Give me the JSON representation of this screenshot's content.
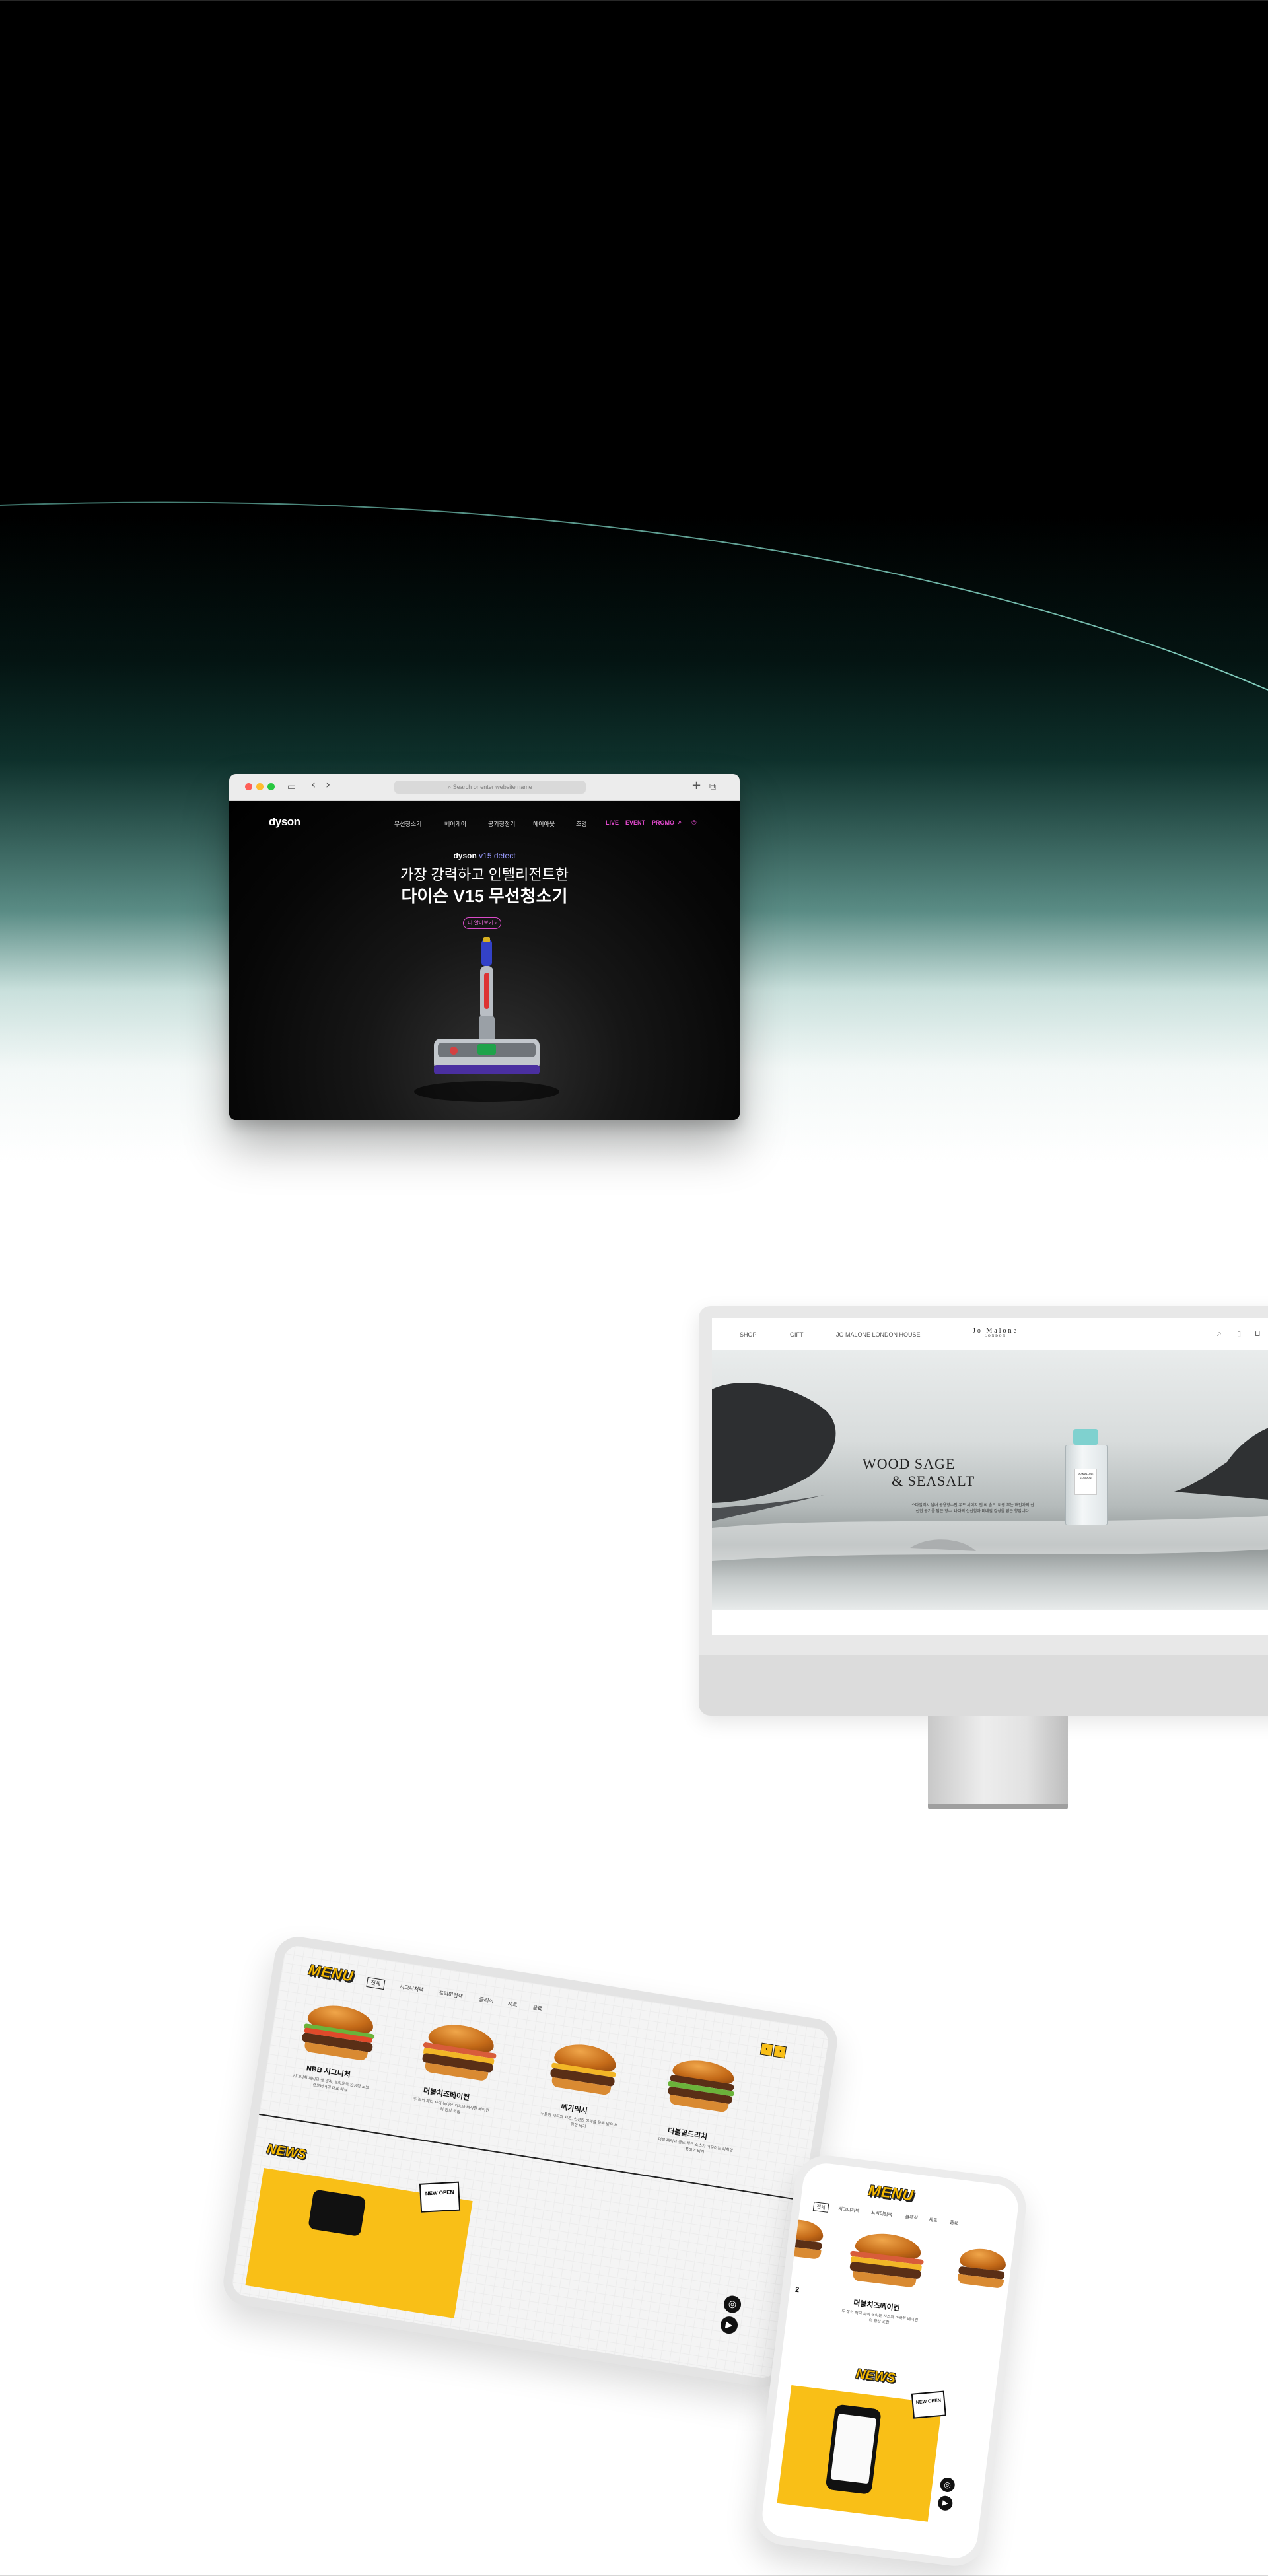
{
  "dyson": {
    "browser": {
      "url_placeholder": "Search or enter website name",
      "back_glyph": "‹",
      "forward_glyph": "›",
      "plus_glyph": "+",
      "tabs_glyph": "⧉",
      "sidebar_glyph": "▭",
      "traffic_colors": [
        "#ff5f57",
        "#febc2e",
        "#28c840"
      ]
    },
    "logo": "dyson",
    "nav": [
      "무선청소기",
      "헤어케어",
      "공기청정기",
      "헤어아웃",
      "조명"
    ],
    "nav_highlight": [
      "LIVE",
      "EVENT",
      "PROMO"
    ],
    "nav_icons": [
      "search-icon",
      "user-icon"
    ],
    "hero": {
      "product_brand": "dyson",
      "product_model": "v15 detect",
      "headline": "가장 강력하고 인텔리전트한",
      "title": "다이슨 V15 무선청소기",
      "cta": "더 알아보기 ›"
    },
    "accent_color": "#e54bd0"
  },
  "jomalone": {
    "nav": [
      "SHOP",
      "GIFT",
      "JO MALONE LONDON HOUSE"
    ],
    "logo_line1": "Jo Malone",
    "logo_line2": "LONDON",
    "icons": [
      "search-icon",
      "bookmark-icon",
      "bag-icon"
    ],
    "hero_title_1": "WOOD SAGE",
    "hero_title_2": "& SEASALT",
    "hero_desc": "스타일리시 남녀 공용향수인 우드 세이지 앤 씨 솔트. 바람 부는 해안가의 신선한 공기를 담은 향수. 바다의 신선함과 미네랄 감성을 담은 향입니다.",
    "bottle_label": "JO MALONE LONDON"
  },
  "burger_tablet": {
    "menu_title": "MENU",
    "tabs": [
      "전체",
      "시그니처팩",
      "프리미엄팩",
      "클래식",
      "세트",
      "음료"
    ],
    "arrow_prev": "‹",
    "arrow_next": "›",
    "items": [
      {
        "name": "NBB 시그니처",
        "desc": "시그니처 패티와 생 양파, 토마토로 완성한 노브랜드버거의 대표 메뉴"
      },
      {
        "name": "더블치즈베이컨",
        "desc": "두 장의 패티 사이 녹아든 치즈와 바삭한 베이컨의 환상 조합"
      },
      {
        "name": "메가맥시",
        "desc": "두툼한 패티와 치즈, 신선한 야채를 듬뿍 넣은 푸짐한 버거"
      },
      {
        "name": "더블골드리치",
        "desc": "더블 패티와 골드 치즈 소스가 어우러진 리치한 풍미의 버거"
      }
    ],
    "news_title": "NEWS",
    "badge": "NEW OPEN",
    "social": [
      "instagram-icon",
      "youtube-icon"
    ]
  },
  "burger_phone": {
    "menu_title": "MENU",
    "tabs": [
      "전체",
      "시그니처팩",
      "프리미엄팩",
      "클래식",
      "세트",
      "음료"
    ],
    "item_left": "2",
    "item_name": "더블치즈베이컨",
    "item_desc": "두 장의 패티 사이 녹아든 치즈와 바삭한 베이컨의 환상 조합",
    "news_title": "NEWS",
    "badge": "NEW OPEN"
  }
}
